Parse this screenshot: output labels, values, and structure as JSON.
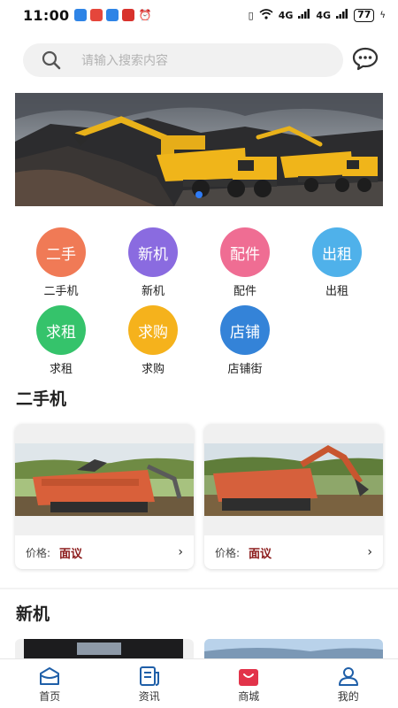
{
  "status_bar": {
    "time": "11:00",
    "signal_text": "4G",
    "battery": "77"
  },
  "search": {
    "placeholder": "请输入搜索内容",
    "search_icon": "search-icon",
    "message_icon": "chat-bubble-icon"
  },
  "banner": {
    "slide_count": 1,
    "active_slide": 1
  },
  "categories": [
    {
      "icon_text": "二手",
      "label": "二手机",
      "color": "#f07a56"
    },
    {
      "icon_text": "新机",
      "label": "新机",
      "color": "#8a6be0"
    },
    {
      "icon_text": "配件",
      "label": "配件",
      "color": "#ef6d93"
    },
    {
      "icon_text": "出租",
      "label": "出租",
      "color": "#4fb1ea"
    },
    {
      "icon_text": "求租",
      "label": "求租",
      "color": "#35c36b"
    },
    {
      "icon_text": "求购",
      "label": "求购",
      "color": "#f5b21c"
    },
    {
      "icon_text": "店铺",
      "label": "店铺街",
      "color": "#3483d8"
    }
  ],
  "sections": {
    "used": {
      "title": "二手机",
      "cards": [
        {
          "price_label": "价格:",
          "price_value": "面议"
        },
        {
          "price_label": "价格:",
          "price_value": "面议"
        }
      ]
    },
    "new": {
      "title": "新机"
    }
  },
  "tabbar": [
    {
      "label": "首页",
      "icon": "home-icon",
      "active": false
    },
    {
      "label": "资讯",
      "icon": "news-icon",
      "active": false
    },
    {
      "label": "商城",
      "icon": "shopping-bag-icon",
      "active": true
    },
    {
      "label": "我的",
      "icon": "user-icon",
      "active": false
    }
  ],
  "colors": {
    "accent": "#e2334a",
    "price": "#8b1a1a",
    "banner_dot_active": "#2f7cf6"
  }
}
